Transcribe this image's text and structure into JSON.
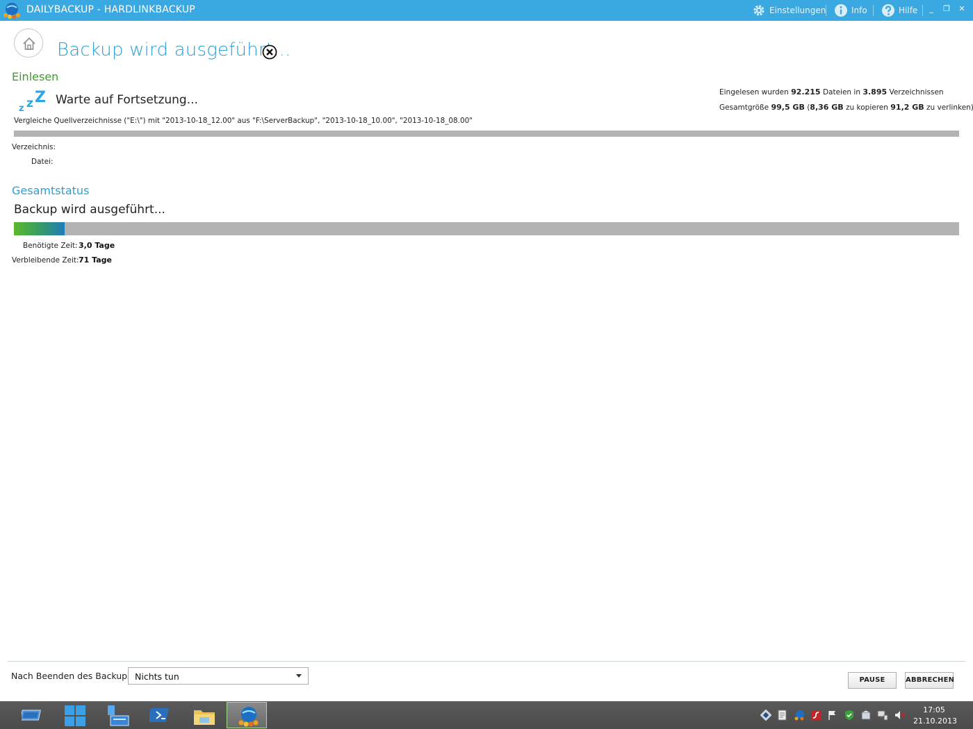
{
  "window": {
    "title": "DAILYBACKUP - HARDLINKBACKUP",
    "menu": {
      "settings": "Einstellungen",
      "info": "Info",
      "help": "Hilfe"
    }
  },
  "header": {
    "title": "Backup wird ausgeführt..."
  },
  "reading": {
    "section_title": "Einlesen",
    "status_text": "Warte auf Fortsetzung...",
    "compare_text": "Vergleiche Quellverzeichnisse (\"E:\\\") mit \"2013-10-18_12.00\" aus \"F:\\ServerBackup\", \"2013-10-18_10.00\", \"2013-10-18_08.00\"",
    "progress": 0,
    "directory_label": "Verzeichnis:",
    "file_label": "Datei:",
    "stats": {
      "read_prefix": "Eingelesen wurden",
      "files_count": "92.215",
      "files_mid": "Dateien in",
      "dirs_count": "3.895",
      "dirs_suffix": "Verzeichnissen",
      "total_label": "Gesamtgröße",
      "total_size": "99,5 GB",
      "open_paren": "(",
      "copy_size": "8,36 GB",
      "copy_label": "zu kopieren",
      "link_size": "91,2 GB",
      "link_label": "zu verlinken)"
    }
  },
  "overall": {
    "section_title": "Gesamtstatus",
    "status_text": "Backup wird ausgeführt...",
    "progress_percent": 5.4,
    "time_needed_label": "Benötigte Zeit:",
    "time_needed_value": "3,0 Tage",
    "time_remaining_label": "Verbleibende Zeit:",
    "time_remaining_value": "71 Tage"
  },
  "footer": {
    "after_backup_label": "Nach Beenden des Backups:",
    "after_backup_value": "Nichts tun",
    "pause_button": "PAUSE",
    "cancel_button": "ABBRECHEN"
  },
  "taskbar": {
    "time": "17:05",
    "date": "21.10.2013"
  },
  "colors": {
    "titlebar": "#3aa9e1",
    "accent_blue": "#2a9fd8",
    "accent_green": "#3d9e2a",
    "progress_track": "#b3b3b3"
  }
}
